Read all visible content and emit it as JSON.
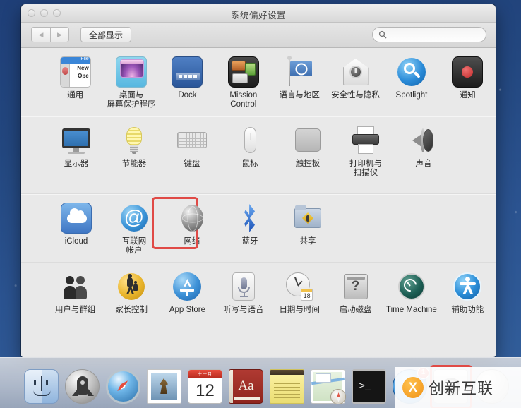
{
  "window": {
    "title": "系统偏好设置",
    "traffic_lights": [
      "close",
      "minimize",
      "zoom"
    ],
    "toolbar": {
      "back_label": "◀",
      "forward_label": "▶",
      "show_all_label": "全部显示",
      "search_placeholder": "",
      "search_value": ""
    }
  },
  "rows": [
    {
      "id": "personal",
      "items": [
        {
          "label": "通用",
          "icon": "general-icon"
        },
        {
          "label": "桌面与\n屏幕保护程序",
          "label_line1": "桌面与",
          "label_line2": "屏幕保护程序",
          "icon": "desktop-screensaver-icon"
        },
        {
          "label": "Dock",
          "icon": "dock-icon"
        },
        {
          "label": "Mission\nControl",
          "label_line1": "Mission",
          "label_line2": "Control",
          "icon": "mission-control-icon"
        },
        {
          "label": "语言与地区",
          "icon": "language-region-icon"
        },
        {
          "label": "安全性与隐私",
          "icon": "security-privacy-icon"
        },
        {
          "label": "Spotlight",
          "icon": "spotlight-icon"
        },
        {
          "label": "通知",
          "icon": "notifications-icon"
        }
      ]
    },
    {
      "id": "hardware",
      "items": [
        {
          "label": "显示器",
          "icon": "displays-icon"
        },
        {
          "label": "节能器",
          "icon": "energy-saver-icon"
        },
        {
          "label": "键盘",
          "icon": "keyboard-icon"
        },
        {
          "label": "鼠标",
          "icon": "mouse-icon"
        },
        {
          "label": "触控板",
          "icon": "trackpad-icon"
        },
        {
          "label": "打印机与\n扫描仪",
          "label_line1": "打印机与",
          "label_line2": "扫描仪",
          "icon": "printers-scanners-icon"
        },
        {
          "label": "声音",
          "icon": "sound-icon"
        }
      ]
    },
    {
      "id": "internet-wireless",
      "items": [
        {
          "label": "iCloud",
          "icon": "icloud-icon"
        },
        {
          "label": "互联网\n帐户",
          "label_line1": "互联网",
          "label_line2": "帐户",
          "icon": "internet-accounts-icon"
        },
        {
          "label": "网络",
          "icon": "network-icon",
          "highlighted": true
        },
        {
          "label": "蓝牙",
          "icon": "bluetooth-icon"
        },
        {
          "label": "共享",
          "icon": "sharing-icon"
        }
      ]
    },
    {
      "id": "system",
      "items": [
        {
          "label": "用户与群组",
          "icon": "users-groups-icon"
        },
        {
          "label": "家长控制",
          "icon": "parental-controls-icon"
        },
        {
          "label": "App Store",
          "icon": "app-store-icon"
        },
        {
          "label": "听写与语音",
          "icon": "dictation-speech-icon"
        },
        {
          "label": "日期与时间",
          "icon": "date-time-icon"
        },
        {
          "label": "启动磁盘",
          "icon": "startup-disk-icon"
        },
        {
          "label": "Time Machine",
          "icon": "time-machine-icon"
        },
        {
          "label": "辅助功能",
          "icon": "accessibility-icon"
        }
      ]
    }
  ],
  "dock": {
    "items": [
      {
        "name": "Finder",
        "icon": "finder-icon"
      },
      {
        "name": "Launchpad",
        "icon": "launchpad-icon"
      },
      {
        "name": "Safari",
        "icon": "safari-icon"
      },
      {
        "name": "Mail",
        "icon": "mail-icon"
      },
      {
        "name": "Calendar",
        "icon": "calendar-icon",
        "month": "十一月",
        "day": "12"
      },
      {
        "name": "Dictionary",
        "icon": "dictionary-icon",
        "glyph": "Aa"
      },
      {
        "name": "Notes",
        "icon": "notes-icon"
      },
      {
        "name": "Maps",
        "icon": "maps-icon"
      },
      {
        "name": "Terminal",
        "icon": "terminal-icon",
        "glyph": ">_"
      },
      {
        "name": "App Store",
        "icon": "app-store-dock-icon",
        "badge": "1"
      },
      {
        "name": "System Preferences",
        "icon": "system-preferences-icon",
        "highlighted": true
      },
      {
        "name": "Disk",
        "icon": "disk-icon"
      }
    ]
  },
  "watermark": {
    "logo_glyph": "X",
    "text": "创新互联"
  },
  "colors": {
    "highlight": "#e04a46",
    "badge": "#d32f2f",
    "accent": "#3a86d8",
    "window_bg": "#e9e9e9",
    "desktop": "#23477f"
  }
}
